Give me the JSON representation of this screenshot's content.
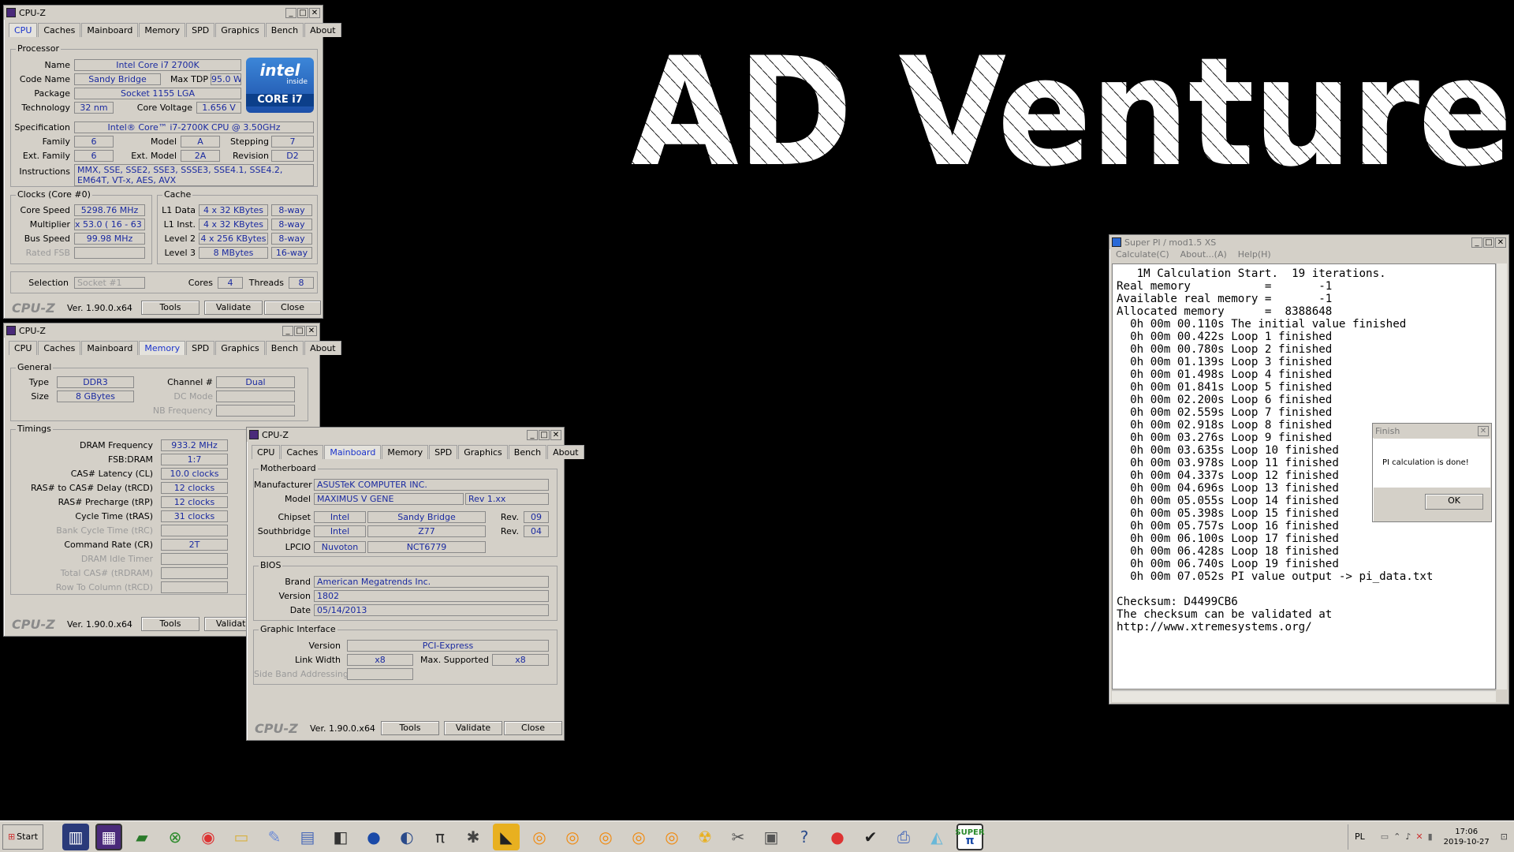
{
  "banner": {
    "text": "AD Venture"
  },
  "cpuz1": {
    "title": "CPU-Z",
    "tabs": [
      "CPU",
      "Caches",
      "Mainboard",
      "Memory",
      "SPD",
      "Graphics",
      "Bench",
      "About"
    ],
    "processor_legend": "Processor",
    "name_label": "Name",
    "name": "Intel Core i7 2700K",
    "codename_label": "Code Name",
    "codename": "Sandy Bridge",
    "maxtdp_label": "Max TDP",
    "maxtdp": "95.0 W",
    "package_label": "Package",
    "package": "Socket 1155 LGA",
    "technology_label": "Technology",
    "technology": "32 nm",
    "corevoltage_label": "Core Voltage",
    "corevoltage": "1.656 V",
    "spec_label": "Specification",
    "spec": "Intel® Core™ i7-2700K CPU @ 3.50GHz",
    "family_label": "Family",
    "family": "6",
    "model_label": "Model",
    "model": "A",
    "stepping_label": "Stepping",
    "stepping": "7",
    "extfamily_label": "Ext. Family",
    "extfamily": "6",
    "extmodel_label": "Ext. Model",
    "extmodel": "2A",
    "revision_label": "Revision",
    "revision": "D2",
    "instructions_label": "Instructions",
    "instructions": "MMX, SSE, SSE2, SSE3, SSSE3, SSE4.1, SSE4.2, EM64T, VT-x, AES, AVX",
    "intel_logo": {
      "top": "intel",
      "mid": "inside",
      "bottom": "CORE i7"
    },
    "clocks_legend": "Clocks (Core #0)",
    "corespeed_label": "Core Speed",
    "corespeed": "5298.76 MHz",
    "multiplier_label": "Multiplier",
    "multiplier": "x 53.0 ( 16 - 63 )",
    "busspeed_label": "Bus Speed",
    "busspeed": "99.98 MHz",
    "ratedfsb_label": "Rated FSB",
    "cache_legend": "Cache",
    "l1data_label": "L1 Data",
    "l1data": "4 x 32 KBytes",
    "l1data_way": "8-way",
    "l1inst_label": "L1 Inst.",
    "l1inst": "4 x 32 KBytes",
    "l1inst_way": "8-way",
    "l2_label": "Level 2",
    "l2": "4 x 256 KBytes",
    "l2_way": "8-way",
    "l3_label": "Level 3",
    "l3": "8 MBytes",
    "l3_way": "16-way",
    "selection_label": "Selection",
    "selection": "Socket #1",
    "cores_label": "Cores",
    "cores": "4",
    "threads_label": "Threads",
    "threads": "8",
    "version": "Ver. 1.90.0.x64",
    "tools": "Tools",
    "validate": "Validate",
    "close": "Close",
    "logo": "CPU-Z"
  },
  "cpuz2": {
    "title": "CPU-Z",
    "general_legend": "General",
    "type_label": "Type",
    "type": "DDR3",
    "channel_label": "Channel #",
    "channel": "Dual",
    "size_label": "Size",
    "size": "8 GBytes",
    "dcmode_label": "DC Mode",
    "nbfreq_label": "NB Frequency",
    "timings_legend": "Timings",
    "dram_label": "DRAM Frequency",
    "dram": "933.2 MHz",
    "fsbdram_label": "FSB:DRAM",
    "fsbdram": "1:7",
    "cl_label": "CAS# Latency (CL)",
    "cl": "10.0 clocks",
    "trcd_label": "RAS# to CAS# Delay (tRCD)",
    "trcd": "12 clocks",
    "trp_label": "RAS# Precharge (tRP)",
    "trp": "12 clocks",
    "tras_label": "Cycle Time (tRAS)",
    "tras": "31 clocks",
    "trc_label": "Bank Cycle Time (tRC)",
    "cr_label": "Command Rate (CR)",
    "cr": "2T",
    "idle_label": "DRAM Idle Timer",
    "trdram_label": "Total CAS# (tRDRAM)",
    "rcd_label": "Row To Column (tRCD)",
    "version": "Ver. 1.90.0.x64",
    "tools": "Tools",
    "validate": "Validate"
  },
  "cpuz3": {
    "title": "CPU-Z",
    "mb_legend": "Motherboard",
    "manufacturer_label": "Manufacturer",
    "manufacturer": "ASUSTeK COMPUTER INC.",
    "model_label": "Model",
    "model": "MAXIMUS V GENE",
    "model_rev": "Rev 1.xx",
    "chipset_label": "Chipset",
    "chipset_vendor": "Intel",
    "chipset": "Sandy Bridge",
    "chipset_rev_label": "Rev.",
    "chipset_rev": "09",
    "south_label": "Southbridge",
    "south_vendor": "Intel",
    "south": "Z77",
    "south_rev_label": "Rev.",
    "south_rev": "04",
    "lpcio_label": "LPCIO",
    "lpcio_vendor": "Nuvoton",
    "lpcio": "NCT6779",
    "bios_legend": "BIOS",
    "brand_label": "Brand",
    "brand": "American Megatrends Inc.",
    "version_label": "Version",
    "bios_version": "1802",
    "date_label": "Date",
    "date": "05/14/2013",
    "gi_legend": "Graphic Interface",
    "giversion_label": "Version",
    "giversion": "PCI-Express",
    "linkwidth_label": "Link Width",
    "linkwidth": "x8",
    "maxsup_label": "Max. Supported",
    "maxsup": "x8",
    "sideband_label": "Side Band Addressing",
    "version": "Ver. 1.90.0.x64",
    "tools": "Tools",
    "validate": "Validate",
    "close": "Close"
  },
  "superpi": {
    "title": "Super PI / mod1.5 XS",
    "menu": [
      "Calculate(C)",
      "About...(A)",
      "Help(H)"
    ],
    "output": "   1M Calculation Start.  19 iterations.\nReal memory           =       -1\nAvailable real memory =       -1\nAllocated memory      =  8388648\n  0h 00m 00.110s The initial value finished\n  0h 00m 00.422s Loop 1 finished\n  0h 00m 00.780s Loop 2 finished\n  0h 00m 01.139s Loop 3 finished\n  0h 00m 01.498s Loop 4 finished\n  0h 00m 01.841s Loop 5 finished\n  0h 00m 02.200s Loop 6 finished\n  0h 00m 02.559s Loop 7 finished\n  0h 00m 02.918s Loop 8 finished\n  0h 00m 03.276s Loop 9 finished\n  0h 00m 03.635s Loop 10 finished\n  0h 00m 03.978s Loop 11 finished\n  0h 00m 04.337s Loop 12 finished\n  0h 00m 04.696s Loop 13 finished\n  0h 00m 05.055s Loop 14 finished\n  0h 00m 05.398s Loop 15 finished\n  0h 00m 05.757s Loop 16 finished\n  0h 00m 06.100s Loop 17 finished\n  0h 00m 06.428s Loop 18 finished\n  0h 00m 06.740s Loop 19 finished\n  0h 00m 07.052s PI value output -> pi_data.txt\n\nChecksum: D4499CB6\nThe checksum can be validated at\nhttp://www.xtremesystems.org/"
  },
  "finish": {
    "title": "Finish",
    "message": "PI calculation is done!",
    "ok": "OK"
  },
  "taskbar": {
    "start": "Start",
    "lang": "PL",
    "time": "17:06",
    "date": "2019-10-27",
    "superpi_icon": "SUPER"
  }
}
